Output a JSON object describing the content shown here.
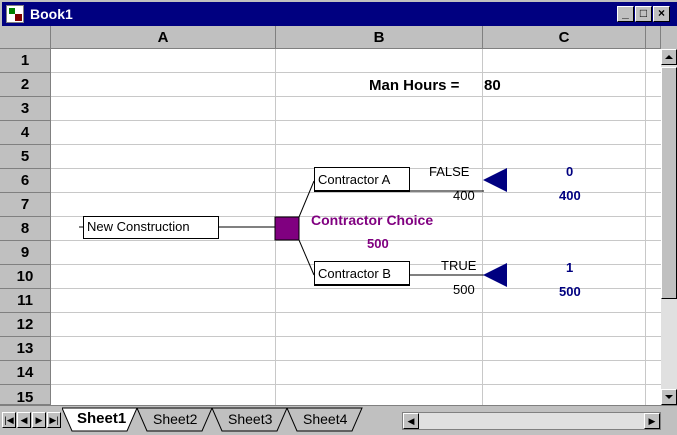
{
  "window": {
    "title": "Book1"
  },
  "columns": [
    "A",
    "B",
    "C"
  ],
  "rows": [
    "1",
    "2",
    "3",
    "4",
    "5",
    "6",
    "7",
    "8",
    "9",
    "10",
    "11",
    "12",
    "13",
    "14",
    "15"
  ],
  "cells": {
    "b2": "Man Hours =",
    "c2": "80",
    "decision_label": "Contractor Choice",
    "decision_value": "500",
    "c5": "0",
    "c6": "400",
    "c9": "1",
    "c10": "500"
  },
  "tree": {
    "root_label": "New Construction",
    "branch_a": {
      "label": "Contractor A",
      "flag": "FALSE",
      "value": "400"
    },
    "branch_b": {
      "label": "Contractor B",
      "flag": "TRUE",
      "value": "500"
    }
  },
  "sheet_tabs": [
    "Sheet1",
    "Sheet2",
    "Sheet3",
    "Sheet4"
  ],
  "active_tab": "Sheet1",
  "colors": {
    "titlebar": "#000080",
    "decision": "#800080",
    "terminal": "#000080",
    "result_text": "#000080"
  }
}
